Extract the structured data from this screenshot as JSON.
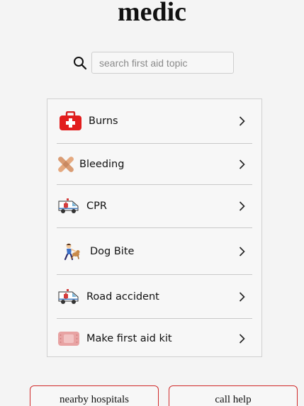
{
  "app": {
    "title": "medic"
  },
  "search": {
    "placeholder": "search first aid topic",
    "value": ""
  },
  "topics": [
    {
      "label": "Burns",
      "icon": "first-aid-kit-icon"
    },
    {
      "label": "Bleeding",
      "icon": "bandage-icon"
    },
    {
      "label": "CPR",
      "icon": "ambulance-icon"
    },
    {
      "label": "Dog Bite",
      "icon": "dog-bite-icon"
    },
    {
      "label": "Road accident",
      "icon": "ambulance-icon"
    },
    {
      "label": "Make first aid kit",
      "icon": "adhesive-bandage-icon"
    }
  ],
  "actions": {
    "hospitals_label": "nearby hospitals",
    "call_label": "call help"
  },
  "colors": {
    "accent": "#d02a2a",
    "background": "#f4f4f4",
    "border": "#d0d0d0"
  }
}
